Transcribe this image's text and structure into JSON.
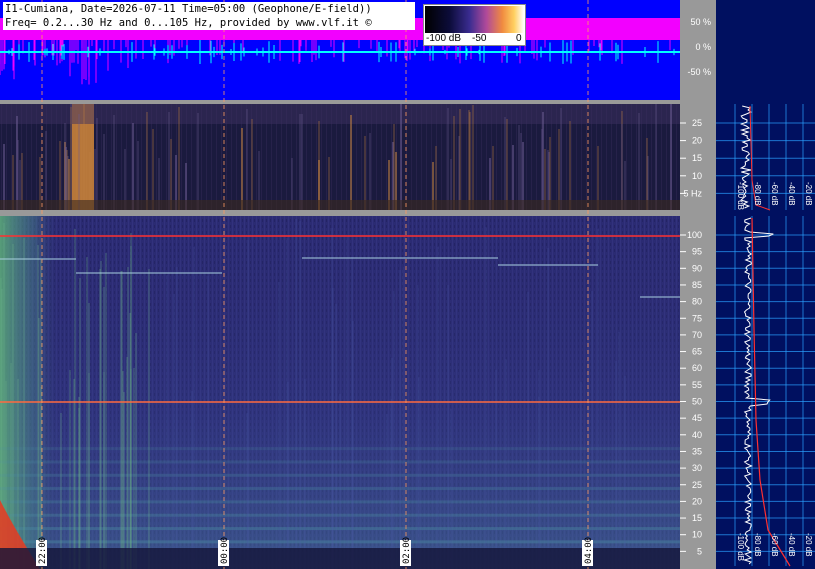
{
  "header": {
    "line1": "I1-Cumiana, Date=2026-07-11 Time=05:00 (Geophone/E-field))",
    "line2": "Freq= 0.2...30 Hz and 0...105 Hz, provided by www.vlf.it ©"
  },
  "color_scale": {
    "labels": [
      "-100 dB",
      "-50",
      "0"
    ],
    "colors": [
      "#000000",
      "#3a2c90",
      "#b04a9a",
      "#f08a40",
      "#ffd060",
      "#ffffff"
    ]
  },
  "time_labels": [
    "22:00",
    "00:00",
    "02:00",
    "04:00"
  ],
  "colors": {
    "waveform_bg": "#0000ff",
    "waveform_magenta": "#ff00ff",
    "waveform_cyan": "#00ffff",
    "sidebar_gray": "#999999",
    "profile_bg": "#001060",
    "grid_cyan": "#2aa0ff",
    "spectrogram_low": "#28286e",
    "line_red": "#ff3030"
  },
  "chart_data": [
    {
      "type": "line",
      "panel": "waveform",
      "ylabel_ticks": [
        "50 %",
        "0 %",
        "-50 %"
      ],
      "y_values": [
        50,
        0,
        -50
      ],
      "unit": "%"
    },
    {
      "type": "heatmap",
      "panel": "spectrogram-low",
      "y_ticks": [
        5,
        10,
        15,
        20,
        25
      ],
      "y_range": [
        0.2,
        30
      ],
      "y_unit": "Hz",
      "tick_labels": [
        "5 Hz",
        "10",
        "15",
        "20",
        "25"
      ],
      "x_labels": [
        "22:00",
        "00:00",
        "02:00",
        "04:00"
      ]
    },
    {
      "type": "heatmap",
      "panel": "spectrogram-high",
      "y_ticks": [
        5,
        10,
        15,
        20,
        25,
        30,
        35,
        40,
        45,
        50,
        55,
        60,
        65,
        70,
        75,
        80,
        85,
        90,
        95,
        100
      ],
      "y_range": [
        0,
        105
      ],
      "x_labels": [
        "22:00",
        "00:00",
        "02:00",
        "04:00"
      ]
    },
    {
      "type": "line",
      "panel": "profile-low",
      "x_ticks": [
        "-100 dB",
        "-80 dB",
        "-60 dB",
        "-40 dB",
        "-20 dB"
      ]
    },
    {
      "type": "line",
      "panel": "profile-high",
      "x_ticks": [
        "-100 dB",
        "-80 dB",
        "-60 dB",
        "-40 dB",
        "-20 dB"
      ]
    }
  ]
}
